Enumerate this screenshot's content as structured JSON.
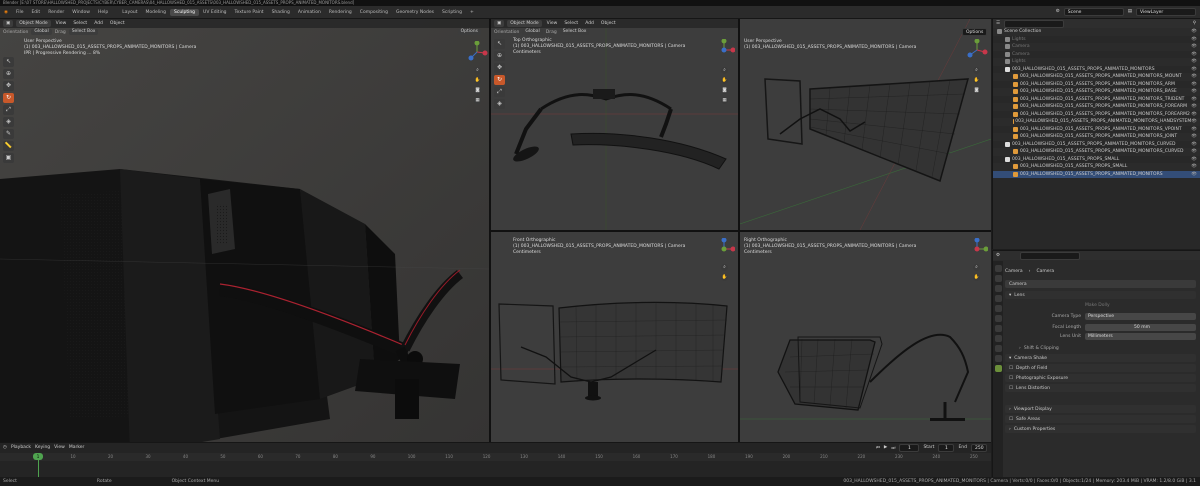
{
  "titlebar": "Blender [E:\\07 STORE\\HALLOWSHED_PROJECTS\\CYBER\\CYBER_CAMERAS\\04_HALLOWSHED_015_ASSETS\\003_HALLOWSHED_015_ASSETS_PROPS_ANIMATED_MONITORS.blend]",
  "menu": [
    "File",
    "Edit",
    "Render",
    "Window",
    "Help"
  ],
  "workspaces": [
    "Layout",
    "Modeling",
    "Sculpting",
    "UV Editing",
    "Texture Paint",
    "Shading",
    "Animation",
    "Rendering",
    "Compositing",
    "Geometry Nodes",
    "Scripting"
  ],
  "active_workspace": "Sculpting",
  "scene": "Scene",
  "view_layer": "ViewLayer",
  "viewports": {
    "persp": {
      "mode": "Object Mode",
      "menus": [
        "View",
        "Select",
        "Add",
        "Object"
      ],
      "orientation": "Orientation",
      "global": "Global",
      "drag": "Drag",
      "select_box": "Select Box",
      "options": "Options",
      "title": "User Perspective",
      "object": "(1) 003_HALLOWSHED_015_ASSETS_PROPS_ANIMATED_MONITORS | Camera",
      "status": "IPR | Progressive Rendering ... 8%"
    },
    "top": {
      "mode": "Object Mode",
      "menus": [
        "View",
        "Select",
        "Add",
        "Object"
      ],
      "orientation": "Orientation",
      "global": "Global",
      "drag": "Drag",
      "select_box": "Select Box",
      "options": "Options",
      "title": "Top Orthographic",
      "object": "(1) 003_HALLOWSHED_015_ASSETS_PROPS_ANIMATED_MONITORS | Camera",
      "scale": "Centimeters"
    },
    "user2": {
      "title": "User Perspective",
      "object": "(1) 003_HALLOWSHED_015_ASSETS_PROPS_ANIMATED_MONITORS | Camera",
      "options": "Options"
    },
    "front": {
      "title": "Front Orthographic",
      "object": "(1) 003_HALLOWSHED_015_ASSETS_PROPS_ANIMATED_MONITORS | Camera",
      "scale": "Centimeters"
    },
    "right": {
      "title": "Right Orthographic",
      "object": "(1) 003_HALLOWSHED_015_ASSETS_PROPS_ANIMATED_MONITORS | Camera",
      "scale": "Centimeters"
    }
  },
  "outliner": {
    "title": "Scene Collection",
    "rows": [
      {
        "label": "Scene Collection",
        "dim": false,
        "sel": false,
        "color": "#888"
      },
      {
        "label": "Lights",
        "dim": true,
        "sel": false,
        "color": "#888"
      },
      {
        "label": "Camera",
        "dim": true,
        "sel": false,
        "color": "#888"
      },
      {
        "label": "Camera",
        "dim": true,
        "sel": false,
        "color": "#888"
      },
      {
        "label": "Lights",
        "dim": true,
        "sel": false,
        "color": "#888"
      },
      {
        "label": "003_HALLOWSHED_015_ASSETS_PROPS_ANIMATED_MONITORS",
        "dim": false,
        "sel": false,
        "color": "#ddd"
      },
      {
        "label": "003_HALLOWSHED_015_ASSETS_PROPS_ANIMATED_MONITORS_MOUNT",
        "dim": false,
        "sel": false,
        "color": "#e09a3a"
      },
      {
        "label": "003_HALLOWSHED_015_ASSETS_PROPS_ANIMATED_MONITORS_ARM",
        "dim": false,
        "sel": false,
        "color": "#e09a3a"
      },
      {
        "label": "003_HALLOWSHED_015_ASSETS_PROPS_ANIMATED_MONITORS_BASE",
        "dim": false,
        "sel": false,
        "color": "#e09a3a"
      },
      {
        "label": "003_HALLOWSHED_015_ASSETS_PROPS_ANIMATED_MONITORS_TRIDENT",
        "dim": false,
        "sel": false,
        "color": "#e09a3a"
      },
      {
        "label": "003_HALLOWSHED_015_ASSETS_PROPS_ANIMATED_MONITORS_FOREARM",
        "dim": false,
        "sel": false,
        "color": "#e09a3a"
      },
      {
        "label": "003_HALLOWSHED_015_ASSETS_PROPS_ANIMATED_MONITORS_FOREARM2",
        "dim": false,
        "sel": false,
        "color": "#e09a3a"
      },
      {
        "label": "003_HALLOWSHED_015_ASSETS_PROPS_ANIMATED_MONITORS_HANDSYSTEM",
        "dim": false,
        "sel": false,
        "color": "#e09a3a"
      },
      {
        "label": "003_HALLOWSHED_015_ASSETS_PROPS_ANIMATED_MONITORS_VPOINT",
        "dim": false,
        "sel": false,
        "color": "#e09a3a"
      },
      {
        "label": "003_HALLOWSHED_015_ASSETS_PROPS_ANIMATED_MONITORS_JOINT",
        "dim": false,
        "sel": false,
        "color": "#e09a3a"
      },
      {
        "label": "003_HALLOWSHED_015_ASSETS_PROPS_ANIMATED_MONITORS_CURVED",
        "dim": false,
        "sel": false,
        "color": "#ddd"
      },
      {
        "label": "003_HALLOWSHED_015_ASSETS_PROPS_ANIMATED_MONITORS_CURVED",
        "dim": false,
        "sel": false,
        "color": "#e09a3a"
      },
      {
        "label": "003_HALLOWSHED_015_ASSETS_PROPS_SMALL",
        "dim": false,
        "sel": false,
        "color": "#ddd"
      },
      {
        "label": "003_HALLOWSHED_015_ASSETS_PROPS_SMALL",
        "dim": false,
        "sel": false,
        "color": "#e09a3a"
      },
      {
        "label": "003_HALLOWSHED_015_ASSETS_PROPS_ANIMATED_MONITORS",
        "dim": false,
        "sel": true,
        "color": "#e09a3a"
      }
    ]
  },
  "properties": {
    "object_name": "Camera",
    "data_name": "Camera",
    "datablock": "Camera",
    "lens_panel": "Lens",
    "make_dolly": "Make Dolly",
    "camera_type_label": "Camera Type",
    "camera_type": "Perspective",
    "focal_length_label": "Focal Length",
    "focal_length": "50 mm",
    "lens_unit_label": "Lens Unit",
    "lens_unit": "Millimeters",
    "shift_clipping": "Shift & Clipping",
    "camera_shake": "Camera Shake",
    "depth_of_field": "Depth of Field",
    "photographic": "Photographic Exposure",
    "lens_distortion": "Lens Distortion",
    "viewport_display": "Viewport Display",
    "safe_areas": "Safe Areas",
    "custom_properties": "Custom Properties"
  },
  "timeline": {
    "menus": [
      "Playback",
      "Keying",
      "View",
      "Marker"
    ],
    "current_frame": "1",
    "start_label": "Start",
    "start": "1",
    "end_label": "End",
    "end": "250",
    "ticks": [
      "0",
      "10",
      "20",
      "30",
      "40",
      "50",
      "60",
      "70",
      "80",
      "90",
      "100",
      "110",
      "120",
      "130",
      "140",
      "150",
      "160",
      "170",
      "180",
      "190",
      "200",
      "210",
      "220",
      "230",
      "240",
      "250"
    ]
  },
  "status": {
    "left": "Select",
    "middle": "Rotate",
    "right_action": "Object Context Menu",
    "info": "003_HALLOWSHED_015_ASSETS_PROPS_ANIMATED_MONITORS | Camera | Verts:0/0 | Faces:0/0 | Objects:1/24 | Memory: 203.4 MiB | VRAM: 1.2/8.0 GiB | 3.1"
  }
}
